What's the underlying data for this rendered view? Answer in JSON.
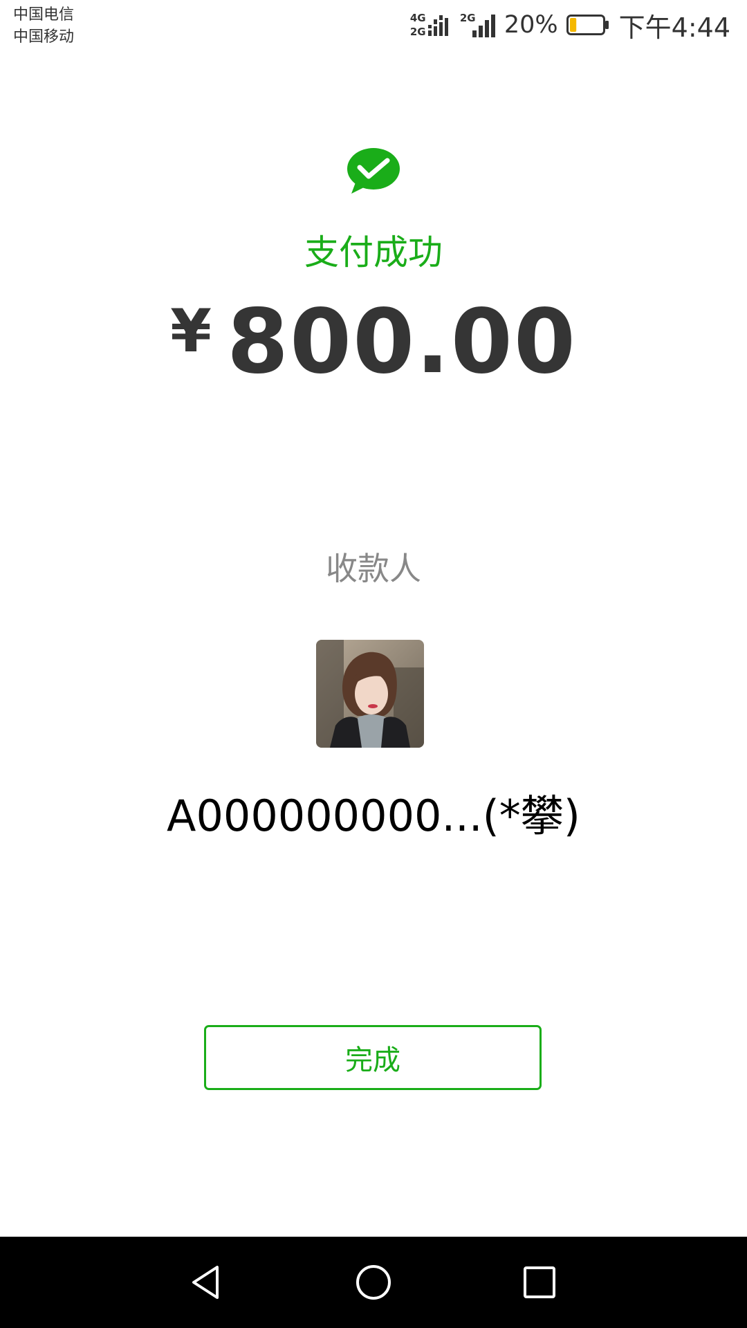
{
  "status_bar": {
    "carriers": [
      "中国电信",
      "中国移动"
    ],
    "network_tag_1": "4G",
    "network_tag_2": "2G",
    "network_tag_3": "2G",
    "battery_percent": "20%",
    "battery_level": 0.2,
    "time": "下午4:44"
  },
  "payment": {
    "status": "支付成功",
    "currency_symbol": "¥",
    "amount": "800.00"
  },
  "payee": {
    "label": "收款人",
    "name": "A000000000...(*攀)"
  },
  "actions": {
    "done_label": "完成"
  },
  "icons": {
    "app_logo": "wechat-pay-logo-icon",
    "nav_back": "back-triangle-icon",
    "nav_home": "home-circle-icon",
    "nav_recent": "recent-apps-square-icon"
  },
  "colors": {
    "accent": "#1AAD19",
    "amount_text": "#353535",
    "label_gray": "#888888",
    "battery_fill": "#F5B800",
    "nav_background": "#000000"
  }
}
